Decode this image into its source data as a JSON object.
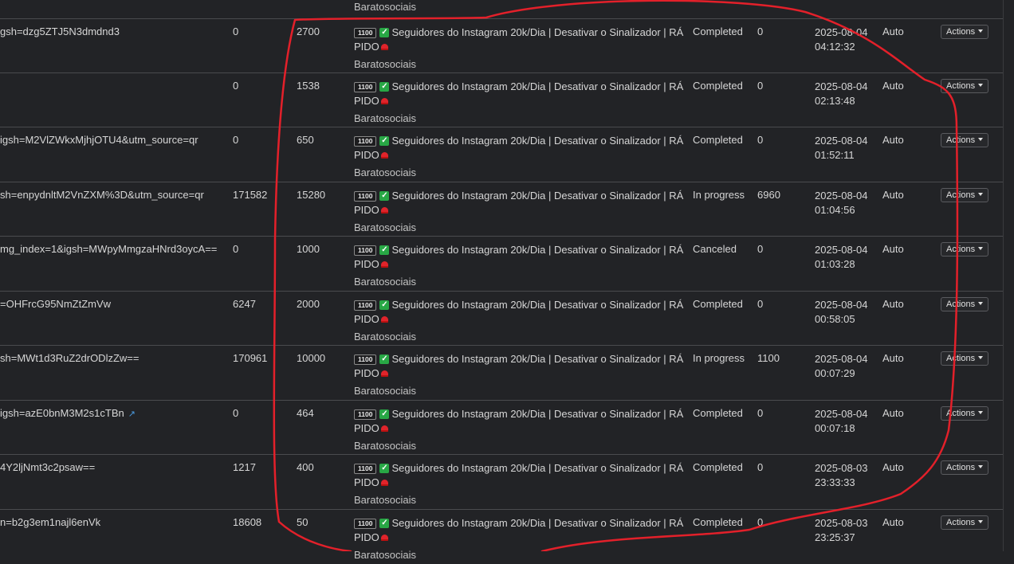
{
  "top_partial_provider": "Baratosociais",
  "service": {
    "id": "1100",
    "name_line1": "Seguidores do Instagram 20k/Dia | Desativar o Sinalizador | RÁ",
    "name_line2": "PIDO",
    "provider": "Baratosociais"
  },
  "actions_label": "Actions",
  "orders": [
    {
      "link": "gsh=dzg5ZTJ5N3dmdnd3",
      "start": "0",
      "quantity": "2700",
      "status": "Completed",
      "remains": "0",
      "date": "2025-08-04",
      "time": "04:12:32",
      "mode": "Auto"
    },
    {
      "link": "",
      "start": "0",
      "quantity": "1538",
      "status": "Completed",
      "remains": "0",
      "date": "2025-08-04",
      "time": "02:13:48",
      "mode": "Auto"
    },
    {
      "link": "igsh=M2VlZWkxMjhjOTU4&utm_source=qr",
      "start": "0",
      "quantity": "650",
      "status": "Completed",
      "remains": "0",
      "date": "2025-08-04",
      "time": "01:52:11",
      "mode": "Auto"
    },
    {
      "link": "sh=enpydnltM2VnZXM%3D&utm_source=qr",
      "start": "171582",
      "quantity": "15280",
      "status": "In progress",
      "remains": "6960",
      "date": "2025-08-04",
      "time": "01:04:56",
      "mode": "Auto"
    },
    {
      "link": "mg_index=1&igsh=MWpyMmgzaHNrd3oycA==",
      "start": "0",
      "quantity": "1000",
      "status": "Canceled",
      "remains": "0",
      "date": "2025-08-04",
      "time": "01:03:28",
      "mode": "Auto"
    },
    {
      "link": "=OHFrcG95NmZtZmVw",
      "start": "6247",
      "quantity": "2000",
      "status": "Completed",
      "remains": "0",
      "date": "2025-08-04",
      "time": "00:58:05",
      "mode": "Auto"
    },
    {
      "link": "sh=MWt1d3RuZ2drODlzZw==",
      "start": "170961",
      "quantity": "10000",
      "status": "In progress",
      "remains": "1100",
      "date": "2025-08-04",
      "time": "00:07:29",
      "mode": "Auto"
    },
    {
      "link": "igsh=azE0bnM3M2s1cTBn",
      "start": "0",
      "quantity": "464",
      "status": "Completed",
      "remains": "0",
      "date": "2025-08-04",
      "time": "00:07:18",
      "mode": "Auto",
      "external": true
    },
    {
      "link": "4Y2ljNmt3c2psaw==",
      "start": "1217",
      "quantity": "400",
      "status": "Completed",
      "remains": "0",
      "date": "2025-08-03",
      "time": "23:33:33",
      "mode": "Auto"
    },
    {
      "link": "n=b2g3em1najl6enVk",
      "start": "18608",
      "quantity": "50",
      "status": "Completed",
      "remains": "0",
      "date": "2025-08-03",
      "time": "23:25:37",
      "mode": "Auto"
    }
  ],
  "colors": {
    "background": "#222326",
    "row_border": "#4a4b4e",
    "check": "#28a745",
    "siren": "#e0242b",
    "annotation": "#e3202a",
    "external_link": "#4a9be0"
  },
  "icons": [
    "check-icon",
    "siren-icon",
    "external-link-icon",
    "caret-down-icon"
  ]
}
